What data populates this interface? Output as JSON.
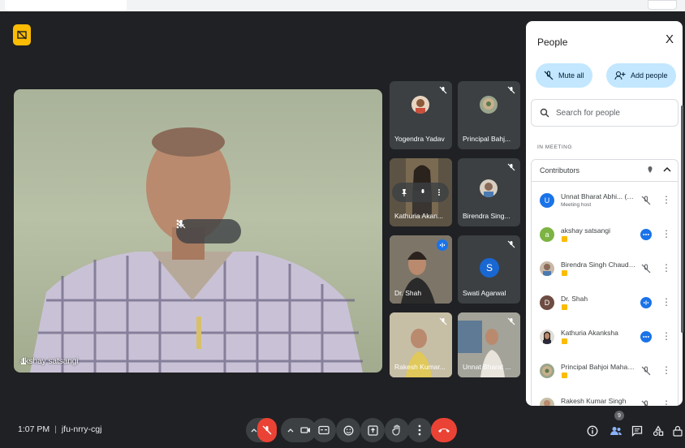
{
  "main_tile": {
    "name": "akshay satsangi"
  },
  "tiles": [
    {
      "name": "Yogendra Yadav"
    },
    {
      "name": "Principal Bahj..."
    },
    {
      "name": "Kathuria Akan..."
    },
    {
      "name": "Birendra Sing..."
    },
    {
      "name": "Dr. Shah"
    },
    {
      "name": "Swati Agarwal",
      "initial": "S"
    },
    {
      "name": "Rakesh Kumar..."
    },
    {
      "name": "Unnat Bharat ..."
    }
  ],
  "panel": {
    "title": "People",
    "close": "X",
    "mute_all": "Mute all",
    "add_people": "Add people",
    "search_placeholder": "Search for people",
    "section": "IN MEETING",
    "group": "Contributors",
    "people": [
      {
        "name": "Unnat Bharat Abhi... (You)",
        "sub": "Meeting host",
        "initial": "U"
      },
      {
        "name": "akshay satsangi",
        "initial": "a"
      },
      {
        "name": "Birendra Singh Chaudha..."
      },
      {
        "name": "Dr. Shah",
        "initial": "D"
      },
      {
        "name": "Kathuria Akanksha"
      },
      {
        "name": "Principal Bahjoi Mahavi..."
      },
      {
        "name": "Rakesh Kumar Singh"
      }
    ]
  },
  "bottom": {
    "time": "1:07 PM",
    "separator": "|",
    "meeting_code": "jfu-nrry-cgj",
    "people_count": "9"
  },
  "colors": {
    "accent": "#1a73e8",
    "end_call": "#ea4335",
    "badge": "#fbbc04",
    "background": "#202124"
  }
}
